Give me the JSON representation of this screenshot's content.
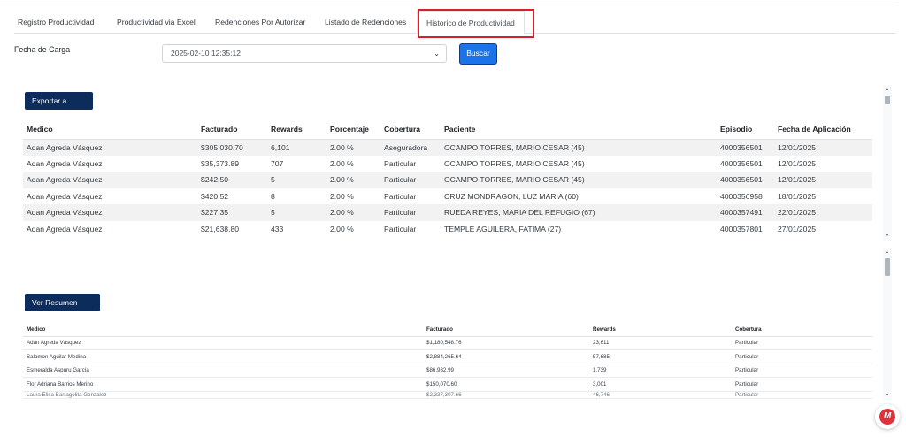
{
  "tabs": [
    {
      "label": "Registro Productividad"
    },
    {
      "label": "Productividad via Excel"
    },
    {
      "label": "Redenciones Por Autorizar"
    },
    {
      "label": "Listado de Redenciones"
    },
    {
      "label": "Historico de Productividad"
    }
  ],
  "active_tab": "Historico de Productividad",
  "filter": {
    "label": "Fecha de Carga",
    "selected": "2025-02-10 12:35:12",
    "search_label": "Buscar"
  },
  "detail": {
    "export_label": "Exportar a Excel",
    "columns": [
      "Medico",
      "Facturado",
      "Rewards",
      "Porcentaje",
      "Cobertura",
      "Paciente",
      "Episodio",
      "Fecha de Aplicación"
    ],
    "rows": [
      [
        "Adan Agreda Vásquez",
        "$305,030.70",
        "6,101",
        "2.00 %",
        "Aseguradora",
        "OCAMPO TORRES, MARIO CESAR (45)",
        "4000356501",
        "12/01/2025"
      ],
      [
        "Adan Agreda Vásquez",
        "$35,373.89",
        "707",
        "2.00 %",
        "Particular",
        "OCAMPO TORRES, MARIO CESAR (45)",
        "4000356501",
        "12/01/2025"
      ],
      [
        "Adan Agreda Vásquez",
        "$242.50",
        "5",
        "2.00 %",
        "Particular",
        "OCAMPO TORRES, MARIO CESAR (45)",
        "4000356501",
        "12/01/2025"
      ],
      [
        "Adan Agreda Vásquez",
        "$420.52",
        "8",
        "2.00 %",
        "Particular",
        "CRUZ MONDRAGON, LUZ MARIA (60)",
        "4000356958",
        "18/01/2025"
      ],
      [
        "Adan Agreda Vásquez",
        "$227.35",
        "5",
        "2.00 %",
        "Particular",
        "RUEDA REYES, MARIA DEL REFUGIO (67)",
        "4000357491",
        "22/01/2025"
      ],
      [
        "Adan Agreda Vásquez",
        "$21,638.80",
        "433",
        "2.00 %",
        "Particular",
        "TEMPLE AGUILERA, FATIMA (27)",
        "4000357801",
        "27/01/2025"
      ]
    ]
  },
  "summary": {
    "pdf_label": "Ver Resumen PDF",
    "columns": [
      "Medico",
      "Facturado",
      "Rewards",
      "Cobertura"
    ],
    "rows": [
      [
        "Adan Agreda Vásquez",
        "$1,180,548.76",
        "23,611",
        "Particular"
      ],
      [
        "Salomon Aguilar Medina",
        "$2,884,265.64",
        "57,685",
        "Particular"
      ],
      [
        "Esmeralda Aspuru García",
        "$86,932.99",
        "1,739",
        "Particular"
      ],
      [
        "Flor Adriana Barrios Merino",
        "$150,070.60",
        "3,001",
        "Particular"
      ],
      [
        "Laura Elisa Barragolita Gonzalez",
        "$2,337,307.66",
        "46,746",
        "Particular"
      ]
    ]
  },
  "colors": {
    "primary_button": "#1a73e8",
    "dark_button": "#0c2c5c",
    "highlight": "#d6202b",
    "row_stripe": "#f2f2f2"
  },
  "icons": [
    "chevron-down-icon",
    "scroll-up-icon",
    "scroll-down-icon",
    "chat-widget-icon"
  ]
}
